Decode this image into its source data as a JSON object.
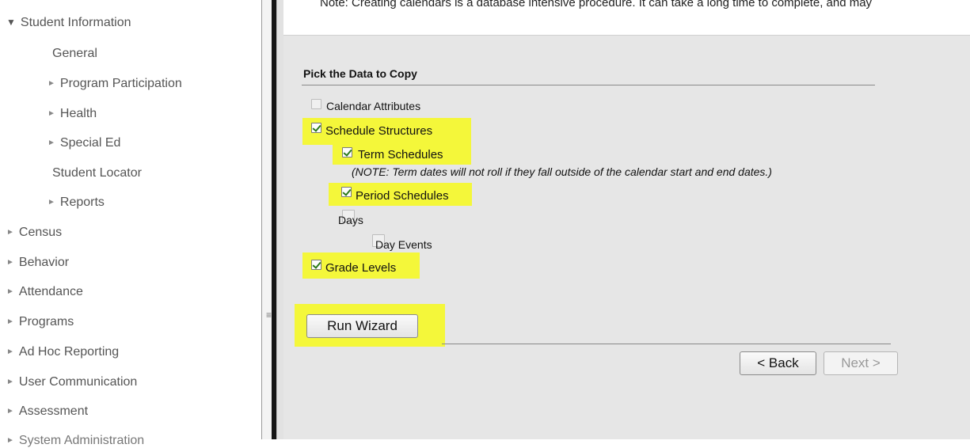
{
  "sidebar": {
    "items": [
      {
        "label": "Student Information",
        "indent": 0,
        "arrow": "expanded"
      },
      {
        "label": "General",
        "indent": 1,
        "arrow": "none"
      },
      {
        "label": "Program Participation",
        "indent": 1,
        "arrow": "collapsed"
      },
      {
        "label": "Health",
        "indent": 1,
        "arrow": "collapsed"
      },
      {
        "label": "Special Ed",
        "indent": 1,
        "arrow": "collapsed"
      },
      {
        "label": "Student Locator",
        "indent": 1,
        "arrow": "none"
      },
      {
        "label": "Reports",
        "indent": 1,
        "arrow": "collapsed"
      },
      {
        "label": "Census",
        "indent": 0,
        "arrow": "collapsed"
      },
      {
        "label": "Behavior",
        "indent": 0,
        "arrow": "collapsed"
      },
      {
        "label": "Attendance",
        "indent": 0,
        "arrow": "collapsed"
      },
      {
        "label": "Programs",
        "indent": 0,
        "arrow": "collapsed"
      },
      {
        "label": "Ad Hoc Reporting",
        "indent": 0,
        "arrow": "collapsed"
      },
      {
        "label": "User Communication",
        "indent": 0,
        "arrow": "collapsed"
      },
      {
        "label": "Assessment",
        "indent": 0,
        "arrow": "collapsed"
      },
      {
        "label": "System Administration",
        "indent": 0,
        "arrow": "collapsed"
      }
    ],
    "arrow_collapsed_glyph": "►",
    "arrow_expanded_glyph": "▼"
  },
  "main": {
    "note": "Note: Creating calendars is a database intensive procedure. It can take a long time to complete, and may",
    "section_title": "Pick the Data to Copy",
    "options": {
      "calendar_attributes": {
        "label": "Calendar Attributes",
        "checked": false
      },
      "schedule_structures": {
        "label": "Schedule Structures",
        "checked": true
      },
      "term_schedules": {
        "label": "Term Schedules",
        "checked": true
      },
      "term_note": "(NOTE: Term dates will not roll if they fall outside of the calendar start and end dates.)",
      "period_schedules": {
        "label": "Period Schedules",
        "checked": true
      },
      "days": {
        "label": "Days",
        "checked": false
      },
      "day_events": {
        "label": "Day Events",
        "checked": false
      },
      "grade_levels": {
        "label": "Grade Levels",
        "checked": true
      }
    },
    "buttons": {
      "run_wizard": "Run Wizard",
      "back": "< Back",
      "next": "Next >"
    },
    "splitter_glyph": "≡"
  },
  "colors": {
    "highlight": "#f4f73a",
    "main_bg": "#e6e6e6",
    "sidebar_text": "#555555"
  }
}
